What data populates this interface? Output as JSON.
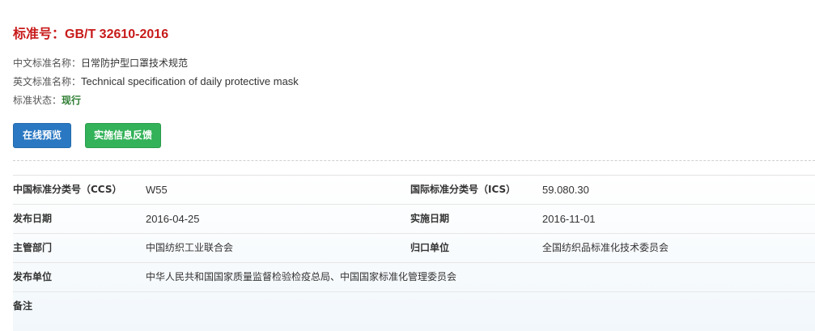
{
  "header": {
    "title_label": "标准号：",
    "title_code": "GB/T 32610-2016"
  },
  "info": {
    "cn_name_label": "中文标准名称：",
    "cn_name": "日常防护型口罩技术规范",
    "en_name_label": "英文标准名称：",
    "en_name": "Technical specification of daily protective mask",
    "status_label": "标准状态：",
    "status": "现行"
  },
  "buttons": {
    "preview": "在线预览",
    "feedback": "实施信息反馈"
  },
  "details": {
    "rows": [
      {
        "k1": "中国标准分类号（CCS）",
        "v1": "W55",
        "k2": "国际标准分类号（ICS）",
        "v2": "59.080.30"
      },
      {
        "k1": "发布日期",
        "v1": "2016-04-25",
        "k2": "实施日期",
        "v2": "2016-11-01"
      },
      {
        "k1": "主管部门",
        "v1": "中国纺织工业联合会",
        "k2": "归口单位",
        "v2": "全国纺织品标准化技术委员会"
      },
      {
        "k1": "发布单位",
        "v1": "中华人民共和国国家质量监督检验检疫总局、中国国家标准化管理委员会",
        "k2": "",
        "v2": ""
      },
      {
        "k1": "备注",
        "v1": "",
        "k2": "",
        "v2": ""
      }
    ]
  },
  "colors": {
    "title": "#c81a1a",
    "status": "#2e7d32",
    "button_primary": "#2a78c2",
    "button_success": "#33b259"
  }
}
